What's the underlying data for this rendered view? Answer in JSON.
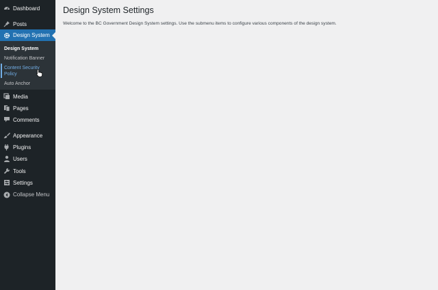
{
  "sidebar": {
    "dashboard": {
      "label": "Dashboard",
      "icon": "dashboard-icon"
    },
    "posts": {
      "label": "Posts",
      "icon": "pin-icon"
    },
    "design_system": {
      "label": "Design System",
      "icon": "gear-icon"
    },
    "submenu": [
      {
        "label": "Design System"
      },
      {
        "label": "Notification Banner"
      },
      {
        "label": "Content Security Policy"
      },
      {
        "label": "Auto Anchor"
      }
    ],
    "media": {
      "label": "Media",
      "icon": "media-icon"
    },
    "pages": {
      "label": "Pages",
      "icon": "pages-icon"
    },
    "comments": {
      "label": "Comments",
      "icon": "comment-icon"
    },
    "appearance": {
      "label": "Appearance",
      "icon": "paintbrush-icon"
    },
    "plugins": {
      "label": "Plugins",
      "icon": "plugin-icon"
    },
    "users": {
      "label": "Users",
      "icon": "user-icon"
    },
    "tools": {
      "label": "Tools",
      "icon": "wrench-icon"
    },
    "settings": {
      "label": "Settings",
      "icon": "settings-icon"
    },
    "collapse": {
      "label": "Collapse Menu",
      "icon": "collapse-icon"
    }
  },
  "main": {
    "title": "Design System Settings",
    "intro": "Welcome to the BC Government Design System settings. Use the submenu items to configure various components of the design system."
  },
  "colors": {
    "sidebar_bg": "#1d2327",
    "accent": "#2271b1",
    "page_bg": "#f0f0f1"
  }
}
